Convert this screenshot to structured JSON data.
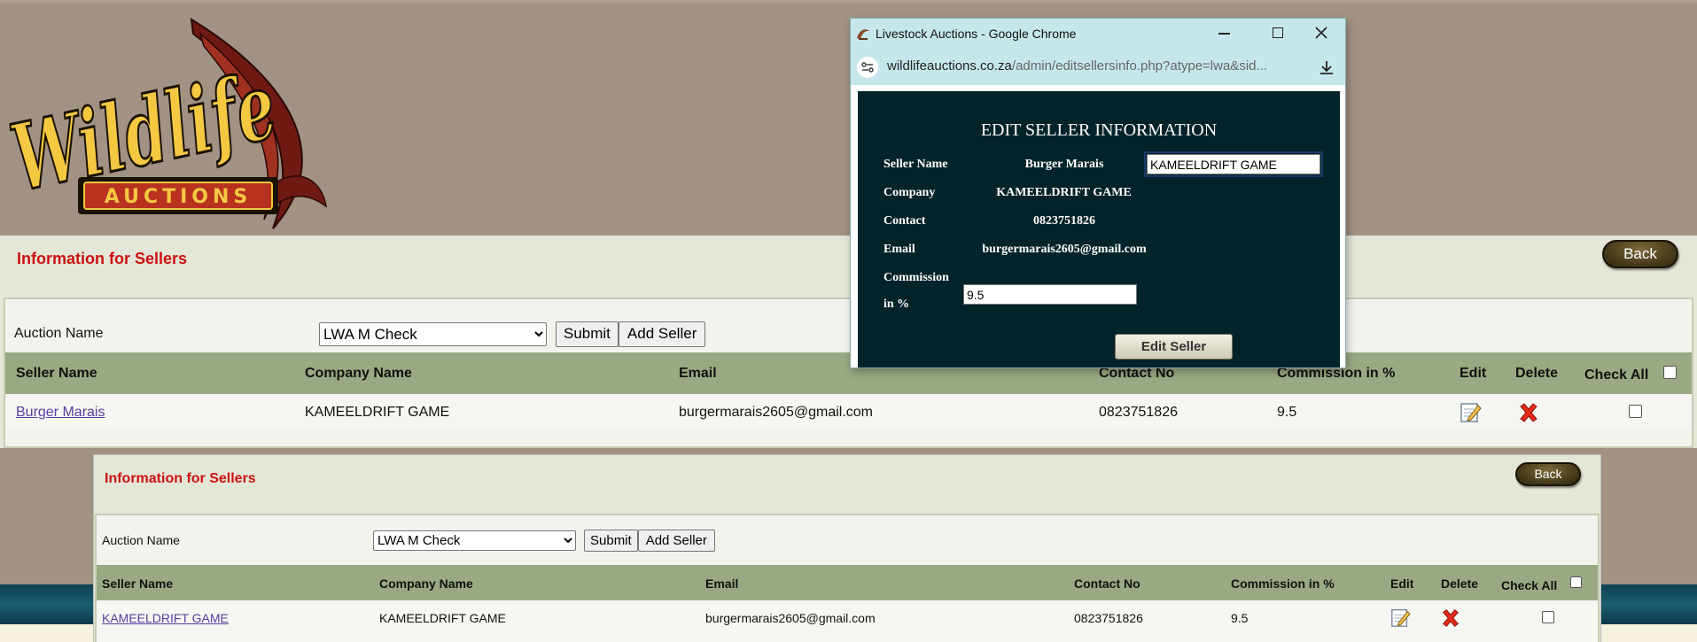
{
  "colors": {
    "title_red": "#cc1111",
    "header_brown": "#a19283",
    "table_head": "#9aa983",
    "popup_bg": "#03232a",
    "chrome_bar": "#c5e7ec"
  },
  "logo": {
    "text": "Wildlife",
    "sub": "AUCTIONS"
  },
  "panel_top": {
    "title": "Information for Sellers",
    "back_label": "Back",
    "auction_label": "Auction Name",
    "auction_selected": "LWA M Check",
    "submit_label": "Submit",
    "add_seller_label": "Add Seller",
    "columns": {
      "seller": "Seller Name",
      "company": "Company Name",
      "email": "Email",
      "contact": "Contact No",
      "commission": "Commission in %",
      "edit": "Edit",
      "delete": "Delete",
      "check_all": "Check All"
    },
    "row": {
      "seller": "Burger Marais",
      "company": "KAMEELDRIFT GAME",
      "email": "burgermarais2605@gmail.com",
      "contact": "0823751826",
      "commission": "9.5"
    }
  },
  "panel_bottom": {
    "title": "Information for Sellers",
    "back_label": "Back",
    "auction_label": "Auction Name",
    "auction_selected": "LWA M Check",
    "submit_label": "Submit",
    "add_seller_label": "Add Seller",
    "columns": {
      "seller": "Seller Name",
      "company": "Company Name",
      "email": "Email",
      "contact": "Contact No",
      "commission": "Commission in %",
      "edit": "Edit",
      "delete": "Delete",
      "check_all": "Check All"
    },
    "row": {
      "seller": "KAMEELDRIFT GAME",
      "company": "KAMEELDRIFT GAME",
      "email": "burgermarais2605@gmail.com",
      "contact": "0823751826",
      "commission": "9.5"
    }
  },
  "popup": {
    "window_title": "Livestock Auctions - Google Chrome",
    "url_domain": "wildlifeauctions.co.za",
    "url_path": "/admin/editsellersinfo.php?atype=lwa&sid...",
    "heading": "EDIT SELLER INFORMATION",
    "seller_label": "Seller Name",
    "seller_value": "Burger Marais",
    "seller_input": "KAMEELDRIFT GAME",
    "company_label": "Company",
    "company_value": "KAMEELDRIFT GAME",
    "contact_label": "Contact",
    "contact_value": "0823751826",
    "email_label": "Email",
    "email_value": "burgermarais2605@gmail.com",
    "commission_label_1": "Commission",
    "commission_label_2": "in %",
    "commission_input": "9.5",
    "edit_button": "Edit Seller"
  }
}
